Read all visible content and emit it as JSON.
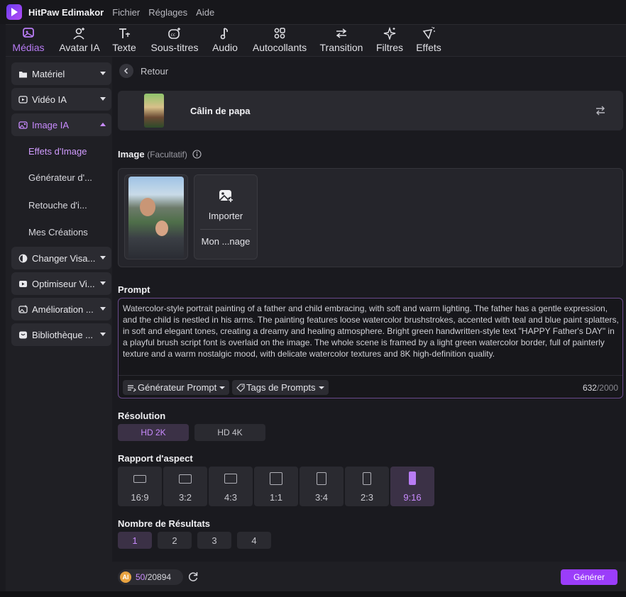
{
  "app": {
    "name": "HitPaw Edimakor",
    "menu": [
      "Fichier",
      "Réglages",
      "Aide"
    ]
  },
  "toolbar": {
    "tools": [
      {
        "label": "Médias",
        "icon": "media-icon",
        "active": true
      },
      {
        "label": "Avatar IA",
        "icon": "avatar-icon",
        "active": false
      },
      {
        "label": "Texte",
        "icon": "text-icon",
        "active": false
      },
      {
        "label": "Sous-titres",
        "icon": "subtitles-icon",
        "active": false
      },
      {
        "label": "Audio",
        "icon": "audio-icon",
        "active": false
      },
      {
        "label": "Autocollants",
        "icon": "stickers-icon",
        "active": false
      },
      {
        "label": "Transition",
        "icon": "transition-icon",
        "active": false
      },
      {
        "label": "Filtres",
        "icon": "filters-icon",
        "active": false
      },
      {
        "label": "Effets",
        "icon": "effects-icon",
        "active": false
      }
    ]
  },
  "sidebar": {
    "items": [
      {
        "label": "Matériel",
        "icon": "folder-icon",
        "open": false
      },
      {
        "label": "Vidéo IA",
        "icon": "video-ai-icon",
        "open": false
      },
      {
        "label": "Image IA",
        "icon": "image-ai-icon",
        "open": true
      },
      {
        "label": "Changer Visa...",
        "icon": "face-swap-icon",
        "open": false
      },
      {
        "label": "Optimiseur Vi...",
        "icon": "video-optimizer-icon",
        "open": false
      },
      {
        "label": "Amélioration ...",
        "icon": "enhance-icon",
        "open": false
      },
      {
        "label": "Bibliothèque ...",
        "icon": "library-icon",
        "open": false
      }
    ],
    "subitems": [
      {
        "label": "Effets d'Image",
        "active": true
      },
      {
        "label": "Générateur d'...",
        "active": false
      },
      {
        "label": "Retouche d'i...",
        "active": false
      },
      {
        "label": "Mes Créations",
        "active": false
      }
    ]
  },
  "main": {
    "back_label": "Retour",
    "style_name": "Câlin de papa",
    "image_section": {
      "title": "Image",
      "optional": "(Facultatif)"
    },
    "import_label": "Importer",
    "mine_label": "Mon ...nage",
    "prompt_title": "Prompt",
    "prompt_text": "Watercolor-style portrait painting of a father and child embracing, with soft and warm lighting. The father has a gentle expression, and the child is nestled in his arms. The painting features loose watercolor brushstrokes, accented with teal and blue paint splatters, in soft and elegant tones, creating a dreamy and healing atmosphere. Bright green handwritten-style text \"HAPPY Father's DAY\" in a playful brush script font is overlaid on the image. The whole scene is framed by a light green watercolor border, full of painterly texture and a warm nostalgic mood, with delicate watercolor textures and 8K high-definition quality.",
    "prompt_generator_label": "Générateur Prompt",
    "prompt_tags_label": "Tags de Prompts",
    "char_count": "632",
    "char_max": "/2000",
    "resolution_title": "Résolution",
    "resolutions": [
      {
        "label": "HD 2K",
        "active": true
      },
      {
        "label": "HD 4K",
        "active": false
      }
    ],
    "aspect_title": "Rapport d'aspect",
    "aspects": [
      {
        "label": "16:9",
        "active": false
      },
      {
        "label": "3:2",
        "active": false
      },
      {
        "label": "4:3",
        "active": false
      },
      {
        "label": "1:1",
        "active": false
      },
      {
        "label": "3:4",
        "active": false
      },
      {
        "label": "2:3",
        "active": false
      },
      {
        "label": "9:16",
        "active": true
      }
    ],
    "count_title": "Nombre de Résultats",
    "counts": [
      {
        "label": "1",
        "active": true
      },
      {
        "label": "2",
        "active": false
      },
      {
        "label": "3",
        "active": false
      },
      {
        "label": "4",
        "active": false
      }
    ]
  },
  "footer": {
    "coin_label": "AI",
    "credits_used": "50",
    "credits_total": "/20894",
    "generate_label": "Générer"
  },
  "colors": {
    "accent": "#b87cf4",
    "primary_button": "#9b3dfa",
    "background": "#1a1a1f"
  }
}
